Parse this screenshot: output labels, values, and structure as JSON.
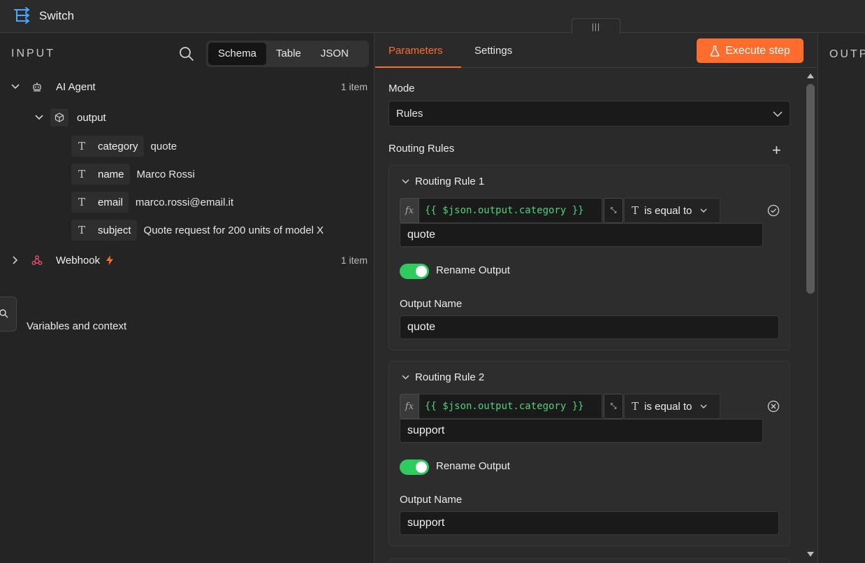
{
  "window": {
    "title": "Switch"
  },
  "input": {
    "title": "INPUT",
    "view_tabs": [
      "Schema",
      "Table",
      "JSON"
    ],
    "active_view": "Schema",
    "nodes": [
      {
        "label": "AI Agent",
        "count": "1 item"
      },
      {
        "label": "Webhook",
        "count": "1 item"
      }
    ],
    "output_node": "output",
    "fields": [
      {
        "key": "category",
        "value": "quote"
      },
      {
        "key": "name",
        "value": "Marco Rossi"
      },
      {
        "key": "email",
        "value": "marco.rossi@email.it"
      },
      {
        "key": "subject",
        "value": "Quote request for 200 units of model X"
      }
    ],
    "variables_label": "Variables and context"
  },
  "params": {
    "tabs": [
      "Parameters",
      "Settings"
    ],
    "active_tab": "Parameters",
    "execute_label": "Execute step",
    "mode_label": "Mode",
    "mode_value": "Rules",
    "routing_rules_label": "Routing Rules",
    "rules": [
      {
        "title": "Routing Rule 1",
        "expression": "{{ $json.output.category }}",
        "operator": "is equal to",
        "value": "quote",
        "rename_label": "Rename Output",
        "rename_on": true,
        "output_name_label": "Output Name",
        "output_name": "quote"
      },
      {
        "title": "Routing Rule 2",
        "expression": "{{ $json.output.category }}",
        "operator": "is equal to",
        "value": "support",
        "rename_label": "Rename Output",
        "rename_on": true,
        "output_name_label": "Output Name",
        "output_name": "support"
      }
    ]
  },
  "output": {
    "title": "OUTPUT"
  },
  "colors": {
    "accent": "#ff6d2e",
    "toggle_on": "#2ecc5f",
    "expression": "#4fd17a"
  }
}
